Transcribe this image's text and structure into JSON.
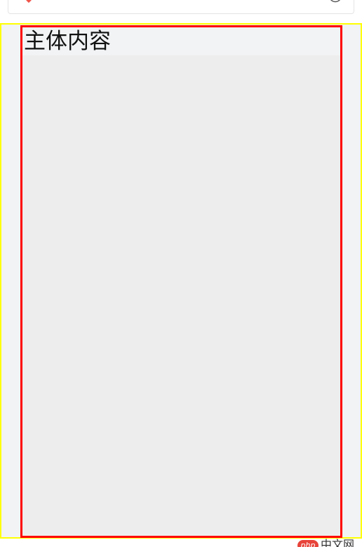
{
  "top_bar": {
    "location_icon": "map-pin-icon",
    "text": "",
    "search_icon": "search-icon"
  },
  "content": {
    "title": "主体内容"
  },
  "watermark": {
    "badge": "php",
    "text": "中文网"
  },
  "colors": {
    "outer_border": "#ffff00",
    "inner_border": "#ff0000",
    "outer_bg": "#f1f3f5",
    "inner_bg": "#ededed",
    "pin": "#f0544a"
  }
}
